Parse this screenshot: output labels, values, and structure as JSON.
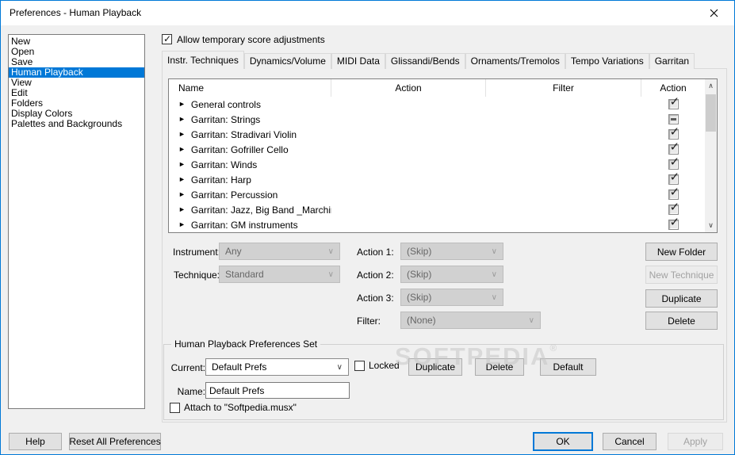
{
  "window": {
    "title": "Preferences - Human Playback"
  },
  "sidebar": {
    "items": [
      "New",
      "Open",
      "Save",
      "Human Playback",
      "View",
      "Edit",
      "Folders",
      "Display Colors",
      "Palettes and Backgrounds"
    ],
    "selected": "Human Playback"
  },
  "allow": {
    "label": "Allow temporary score adjustments",
    "checked": true
  },
  "tabs": {
    "items": [
      "Instr. Techniques",
      "Dynamics/Volume",
      "MIDI Data",
      "Glissandi/Bends",
      "Ornaments/Tremolos",
      "Tempo Variations",
      "Garritan"
    ],
    "active": "Instr. Techniques"
  },
  "techniques_table": {
    "columns": [
      "Name",
      "Action",
      "Filter",
      "Action"
    ],
    "rows": [
      {
        "name": "General controls",
        "action": "",
        "filter": "",
        "checkbox": "checked"
      },
      {
        "name": "Garritan: Strings",
        "action": "",
        "filter": "",
        "checkbox": "mixed"
      },
      {
        "name": "Garritan: Stradivari Violin",
        "action": "",
        "filter": "",
        "checkbox": "checked"
      },
      {
        "name": "Garritan: Gofriller Cello",
        "action": "",
        "filter": "",
        "checkbox": "checked"
      },
      {
        "name": "Garritan: Winds",
        "action": "",
        "filter": "",
        "checkbox": "checked"
      },
      {
        "name": "Garritan: Harp",
        "action": "",
        "filter": "",
        "checkbox": "checked"
      },
      {
        "name": "Garritan: Percussion",
        "action": "",
        "filter": "",
        "checkbox": "checked"
      },
      {
        "name": "Garritan: Jazz, Big Band _Marchin...",
        "action": "",
        "filter": "",
        "checkbox": "checked"
      },
      {
        "name": "Garritan: GM instruments",
        "action": "",
        "filter": "",
        "checkbox": "checked"
      }
    ]
  },
  "editors": {
    "instrument": {
      "label": "Instrument:",
      "value": "Any",
      "enabled": false
    },
    "technique": {
      "label": "Technique:",
      "value": "Standard",
      "enabled": false
    },
    "action1": {
      "label": "Action 1:",
      "value": "(Skip)",
      "enabled": false
    },
    "action2": {
      "label": "Action 2:",
      "value": "(Skip)",
      "enabled": false
    },
    "action3": {
      "label": "Action 3:",
      "value": "(Skip)",
      "enabled": false
    },
    "filter": {
      "label": "Filter:",
      "value": "(None)",
      "enabled": false
    }
  },
  "side_buttons": {
    "new_folder": "New Folder",
    "new_technique": "New Technique",
    "duplicate": "Duplicate",
    "delete": "Delete"
  },
  "prefs_set": {
    "title": "Human Playback Preferences Set",
    "current_label": "Current:",
    "current_value": "Default Prefs",
    "locked_label": "Locked",
    "duplicate_label": "Duplicate",
    "delete_label": "Delete",
    "default_label": "Default",
    "name_label": "Name:",
    "name_value": "Default Prefs",
    "attach_label": "Attach to \"Softpedia.musx\"",
    "attach_checked": false,
    "locked_checked": false
  },
  "watermark": {
    "text": "SOFTPEDIA",
    "reg": "®"
  },
  "footer": {
    "help": "Help",
    "reset": "Reset All Preferences",
    "ok": "OK",
    "cancel": "Cancel",
    "apply": "Apply"
  },
  "icons": {
    "row_expand": "►",
    "check": "✓",
    "scroll_up": "∧",
    "scroll_down": "∨",
    "combo_chevron": "∨"
  },
  "colors": {
    "accent": "#0078d7",
    "selection_bg": "#0078d7",
    "dialog_bg": "#f0f0f0"
  }
}
